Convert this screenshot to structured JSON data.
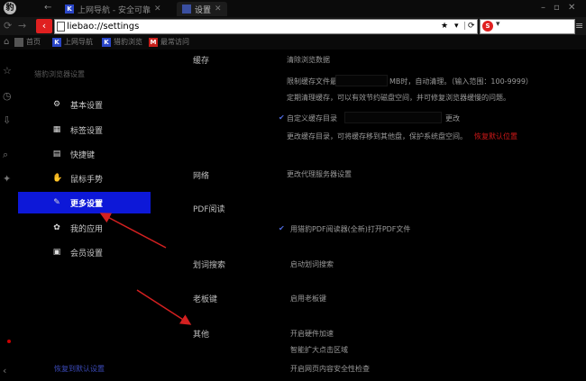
{
  "tabs": {
    "logo": "豹",
    "items": [
      {
        "fav": "K",
        "label": "上网导航 - 安全可靠",
        "active": false
      },
      {
        "fav": "",
        "label": "设置",
        "active": true
      }
    ]
  },
  "toolbar": {
    "address": "liebao://settings",
    "search_logo": "S"
  },
  "bookmarks": [
    {
      "icon": "K",
      "label": "首页"
    },
    {
      "icon": "K",
      "label": "上网导航"
    },
    {
      "icon": "K",
      "label": "猎豹浏览"
    },
    {
      "icon": "M",
      "label": "最常访问"
    }
  ],
  "nav": {
    "heading": "猎豹浏览器设置",
    "items": [
      {
        "label": "基本设置",
        "icon": "⚙"
      },
      {
        "label": "标签设置",
        "icon": "▦"
      },
      {
        "label": "快捷键",
        "icon": "▤"
      },
      {
        "label": "鼠标手势",
        "icon": "✋"
      },
      {
        "label": "更多设置",
        "icon": "✎"
      },
      {
        "label": "我的应用",
        "icon": "✿"
      },
      {
        "label": "会员设置",
        "icon": "▣"
      }
    ],
    "footer": "恢复到默认设置"
  },
  "sections": {
    "cache": {
      "label": "缓存",
      "title": "清除浏览数据",
      "limit_prefix": "限制缓存文件最大",
      "limit_suffix": "MB时，自动清理。（输入范围：100-9999）",
      "limit_note": "定期清理缓存，可以有效节约磁盘空间，并可修复浏览器缓慢的问题。",
      "dir_label": "自定义缓存目录",
      "dir_change": "更改",
      "dir_note": "更改缓存目录，可将缓存移到其他盘，保护系统盘空间。",
      "dir_reset": "恢复默认位置"
    },
    "network": {
      "label": "网络",
      "proxy": "更改代理服务器设置"
    },
    "pdf": {
      "label": "PDF阅读",
      "option": "用猎豹PDF阅读器(全新)打开PDF文件"
    },
    "search": {
      "label": "划词搜索",
      "option": "启动划词搜索"
    },
    "bosskey": {
      "label": "老板键",
      "option": "启用老板键"
    },
    "other": {
      "label": "其他",
      "options": [
        "开启硬件加速",
        "智能扩大点击区域",
        "开启网页内容安全性检查"
      ]
    }
  }
}
